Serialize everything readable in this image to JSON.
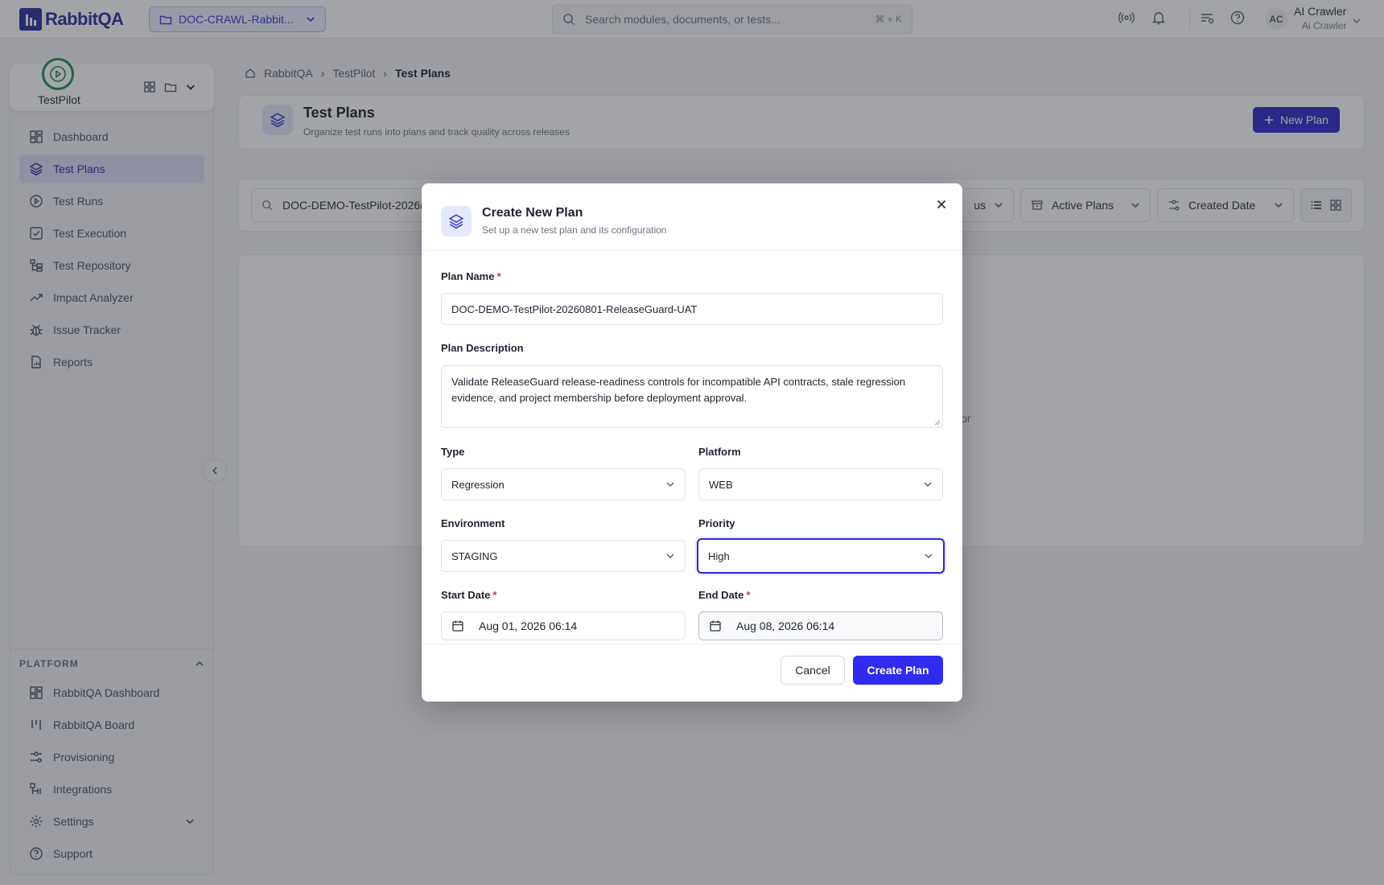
{
  "app": {
    "logo_text": "RabbitQA",
    "brand_color": "#2b2f9c",
    "accent_color": "#2f2bc7"
  },
  "header": {
    "project": "DOC-CRAWL-Rabbit...",
    "search_placeholder": "Search modules, documents, or tests...",
    "search_shortcut": "⌘ + K",
    "user_initials": "AC",
    "user_name": "AI Crawler",
    "user_org": "Ai Crawler"
  },
  "sidebar": {
    "module": "TestPilot",
    "items": [
      {
        "label": "Dashboard",
        "icon": "dashboard-icon"
      },
      {
        "label": "Test Plans",
        "icon": "layers-icon",
        "active": true
      },
      {
        "label": "Test Runs",
        "icon": "play-circle-icon"
      },
      {
        "label": "Test Execution",
        "icon": "check-square-icon"
      },
      {
        "label": "Test Repository",
        "icon": "repository-icon"
      },
      {
        "label": "Impact Analyzer",
        "icon": "trend-icon"
      },
      {
        "label": "Issue Tracker",
        "icon": "bug-icon"
      },
      {
        "label": "Reports",
        "icon": "report-icon"
      }
    ],
    "platform_heading": "PLATFORM",
    "platform_items": [
      {
        "label": "RabbitQA Dashboard",
        "icon": "dashboard-icon"
      },
      {
        "label": "RabbitQA Board",
        "icon": "board-icon"
      },
      {
        "label": "Provisioning",
        "icon": "sliders-icon"
      },
      {
        "label": "Integrations",
        "icon": "integrations-icon"
      },
      {
        "label": "Settings",
        "icon": "gear-icon"
      },
      {
        "label": "Support",
        "icon": "help-icon"
      }
    ]
  },
  "main": {
    "breadcrumb": [
      "RabbitQA",
      "TestPilot",
      "Test Plans"
    ],
    "title": "Test Plans",
    "subtitle": "Organize test runs into plans and track quality across releases",
    "new_plan_label": "New Plan",
    "filter_search_value": "DOC-DEMO-TestPilot-2026(",
    "filter_status_partial": "us",
    "filter_active": "Active Plans",
    "filter_sort": "Created Date",
    "bg_hint_partial": "or"
  },
  "modal": {
    "title": "Create New Plan",
    "subtitle": "Set up a new test plan and its configuration",
    "plan_name_label": "Plan Name",
    "required_mark": "*",
    "plan_name_value": "DOC-DEMO-TestPilot-20260801-ReleaseGuard-UAT",
    "description_label": "Plan Description",
    "description_value": "Validate ReleaseGuard release-readiness controls for incompatible API contracts, stale regression evidence, and project membership before deployment approval.",
    "type_label": "Type",
    "type_value": "Regression",
    "platform_label": "Platform",
    "platform_value": "WEB",
    "environment_label": "Environment",
    "environment_value": "STAGING",
    "priority_label": "Priority",
    "priority_value": "High",
    "start_label": "Start Date",
    "start_value": "Aug 01, 2026 06:14",
    "end_label": "End Date",
    "end_value": "Aug 08, 2026 06:14",
    "cancel_label": "Cancel",
    "create_label": "Create Plan"
  }
}
